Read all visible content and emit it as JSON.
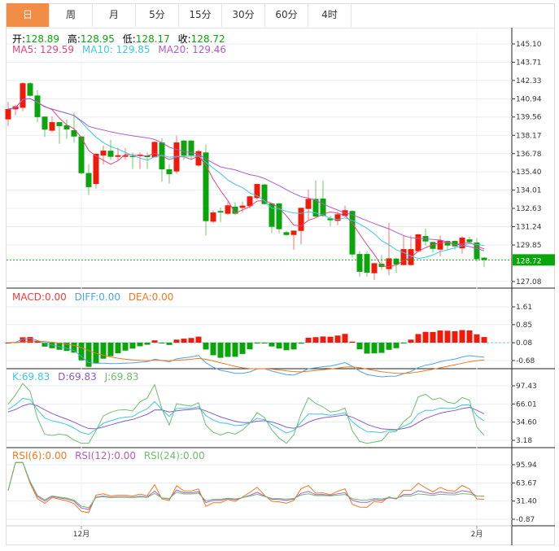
{
  "tabs": [
    "日",
    "周",
    "月",
    "5分",
    "15分",
    "30分",
    "60分",
    "4时"
  ],
  "active_tab": 0,
  "ohlc_header": {
    "open_label": "开:",
    "open": "128.89",
    "high_label": "高:",
    "high": "128.95",
    "low_label": "低:",
    "low": "128.17",
    "close_label": "收:",
    "close": "128.72"
  },
  "ma_header": {
    "ma5": "MA5: 129.59",
    "ma10": "MA10: 129.85",
    "ma20": "MA20: 129.46"
  },
  "macd_header": {
    "macd": "MACD:0.00",
    "diff": "DIFF:0.00",
    "dea": "DEA:0.00"
  },
  "kdj_header": {
    "k": "K:69.83",
    "d": "D:69.83",
    "j": "J:69.83"
  },
  "rsi_header": {
    "rsi6": "RSI(6):0.00",
    "rsi12": "RSI(12):0.00",
    "rsi24": "RSI(24):0.00"
  },
  "colors": {
    "up": "#f01a0a",
    "down": "#0aa50a",
    "ma5": "#e8437a",
    "ma10": "#3cc8e0",
    "ma20": "#b05cc8",
    "diff": "#4aa3e8",
    "dea": "#f07820",
    "k": "#3cc8e0",
    "d": "#8a5cc8",
    "j": "#6cbf6c",
    "rsi6": "#f07820",
    "rsi12": "#b05cc8",
    "rsi24": "#6cbf6c",
    "accent": "#f28d45"
  },
  "chart_data": {
    "type": "candlestick",
    "price_axis": [
      "145.10",
      "143.71",
      "142.33",
      "140.94",
      "139.56",
      "138.17",
      "136.78",
      "135.40",
      "134.01",
      "132.63",
      "131.24",
      "129.85",
      "127.08"
    ],
    "price_range": [
      127.08,
      145.1
    ],
    "current_price": "128.72",
    "macd_axis": [
      "1.61",
      "0.85",
      "0.08",
      "-0.68"
    ],
    "kdj_axis": [
      "97.43",
      "66.01",
      "34.60",
      "3.18"
    ],
    "rsi_axis": [
      "95.94",
      "63.67",
      "31.40",
      "-0.87"
    ],
    "x_labels": [
      {
        "label": "12月",
        "index": 10
      },
      {
        "label": "2月",
        "index": 64
      }
    ],
    "candles": [
      [
        139.38,
        140.72,
        138.87,
        140.16
      ],
      [
        140.14,
        140.5,
        139.69,
        140.37
      ],
      [
        140.26,
        142.2,
        140.0,
        142.12
      ],
      [
        142.12,
        142.2,
        141.1,
        141.17
      ],
      [
        141.19,
        141.58,
        139.17,
        139.55
      ],
      [
        139.59,
        139.6,
        138.04,
        138.6
      ],
      [
        138.52,
        139.59,
        138.39,
        139.17
      ],
      [
        139.17,
        139.2,
        137.53,
        138.87
      ],
      [
        138.93,
        139.38,
        137.9,
        138.62
      ],
      [
        138.56,
        139.9,
        137.63,
        138.08
      ],
      [
        138.08,
        138.1,
        135.2,
        135.3
      ],
      [
        135.31,
        135.97,
        133.66,
        134.24
      ],
      [
        134.48,
        136.8,
        134.13,
        136.77
      ],
      [
        136.64,
        137.4,
        135.96,
        137.01
      ],
      [
        137.0,
        137.84,
        136.3,
        136.54
      ],
      [
        136.54,
        137.22,
        136.25,
        136.66
      ],
      [
        136.54,
        137.22,
        136.3,
        136.66
      ],
      [
        136.6,
        136.87,
        135.62,
        136.52
      ],
      [
        136.68,
        136.87,
        135.62,
        136.7
      ],
      [
        136.64,
        136.87,
        135.62,
        136.52
      ],
      [
        136.5,
        137.7,
        136.5,
        137.67
      ],
      [
        137.63,
        137.94,
        134.65,
        135.59
      ],
      [
        135.59,
        135.98,
        134.5,
        135.22
      ],
      [
        135.43,
        138.15,
        135.27,
        137.63
      ],
      [
        137.77,
        137.8,
        136.3,
        136.64
      ],
      [
        137.77,
        137.8,
        136.36,
        136.64
      ],
      [
        135.88,
        137.1,
        135.78,
        136.97
      ],
      [
        136.87,
        137.47,
        130.57,
        131.66
      ],
      [
        131.62,
        132.49,
        131.5,
        132.32
      ],
      [
        132.43,
        132.69,
        131.6,
        132.32
      ],
      [
        132.22,
        133.15,
        132.12,
        132.86
      ],
      [
        132.76,
        133.1,
        132.12,
        132.22
      ],
      [
        132.67,
        133.15,
        132.3,
        132.84
      ],
      [
        132.8,
        133.6,
        132.65,
        133.54
      ],
      [
        133.41,
        134.5,
        133.3,
        134.48
      ],
      [
        134.44,
        134.5,
        132.9,
        132.96
      ],
      [
        133.0,
        133.0,
        130.74,
        131.23
      ],
      [
        133.0,
        133.06,
        130.74,
        131.05
      ],
      [
        130.82,
        130.94,
        130.55,
        130.61
      ],
      [
        130.61,
        130.95,
        129.5,
        130.94
      ],
      [
        130.92,
        132.7,
        129.91,
        132.67
      ],
      [
        132.59,
        134.03,
        131.77,
        133.35
      ],
      [
        133.35,
        134.75,
        132.0,
        132.01
      ],
      [
        133.37,
        134.75,
        132.0,
        132.05
      ],
      [
        131.87,
        132.08,
        131.29,
        131.73
      ],
      [
        131.68,
        132.38,
        131.36,
        132.18
      ],
      [
        132.05,
        132.84,
        132.0,
        132.49
      ],
      [
        132.43,
        132.5,
        128.89,
        129.13
      ],
      [
        129.17,
        129.4,
        127.45,
        127.82
      ],
      [
        129.17,
        129.4,
        127.45,
        127.75
      ],
      [
        127.71,
        128.5,
        127.2,
        128.47
      ],
      [
        128.43,
        129.09,
        127.96,
        128.18
      ],
      [
        128.02,
        131.52,
        127.55,
        128.84
      ],
      [
        128.82,
        128.9,
        127.75,
        128.37
      ],
      [
        128.33,
        130.53,
        128.3,
        129.54
      ],
      [
        128.33,
        130.57,
        128.3,
        129.54
      ],
      [
        129.38,
        130.7,
        129.3,
        130.66
      ],
      [
        130.53,
        131.09,
        129.81,
        130.12
      ],
      [
        130.08,
        130.1,
        129.26,
        129.56
      ],
      [
        129.5,
        130.57,
        128.99,
        130.2
      ],
      [
        130.16,
        130.2,
        129.5,
        129.81
      ],
      [
        130.16,
        130.2,
        129.5,
        129.75
      ],
      [
        129.6,
        130.53,
        129.19,
        130.41
      ],
      [
        130.28,
        130.47,
        130.0,
        130.08
      ],
      [
        130.04,
        130.37,
        128.58,
        128.78
      ],
      [
        128.89,
        128.95,
        128.17,
        128.72
      ]
    ]
  }
}
